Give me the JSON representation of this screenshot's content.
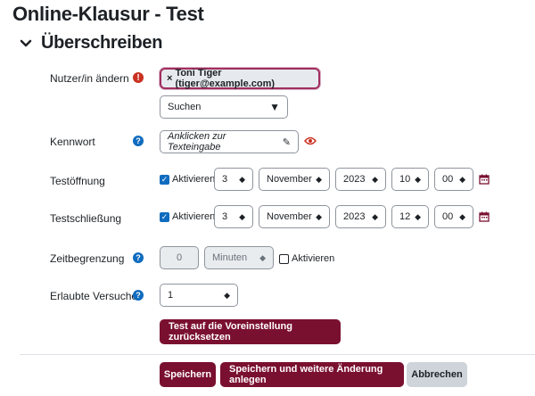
{
  "page": {
    "title": "Online-Klausur - Test"
  },
  "section": {
    "title": "Überschreiben"
  },
  "user": {
    "label": "Nutzer/in ändern",
    "selected": "Toni Tiger (tiger@example.com)",
    "remove_glyph": "×",
    "search_placeholder": "Suchen"
  },
  "password": {
    "label": "Kennwort",
    "placeholder": "Anklicken zur Texteingabe"
  },
  "open": {
    "label": "Testöffnung",
    "enable": "Aktivieren",
    "enabled": true,
    "day": "3",
    "month": "November",
    "year": "2023",
    "hour": "10",
    "minute": "00"
  },
  "close": {
    "label": "Testschließung",
    "enable": "Aktivieren",
    "enabled": true,
    "day": "3",
    "month": "November",
    "year": "2023",
    "hour": "12",
    "minute": "00"
  },
  "timelimit": {
    "label": "Zeitbegrenzung",
    "value": "0",
    "unit": "Minuten",
    "enable": "Aktivieren",
    "enabled": false
  },
  "attempts": {
    "label": "Erlaubte Versuche",
    "value": "1"
  },
  "buttons": {
    "reset": "Test auf die Voreinstellung zurücksetzen",
    "save": "Speichern",
    "save_add": "Speichern und weitere Änderung anlegen",
    "cancel": "Abbrechen"
  },
  "colors": {
    "primary": "#7a1030",
    "help": "#0f6cbf",
    "error": "#ca3120",
    "checkbox": "#0f6cbf"
  }
}
